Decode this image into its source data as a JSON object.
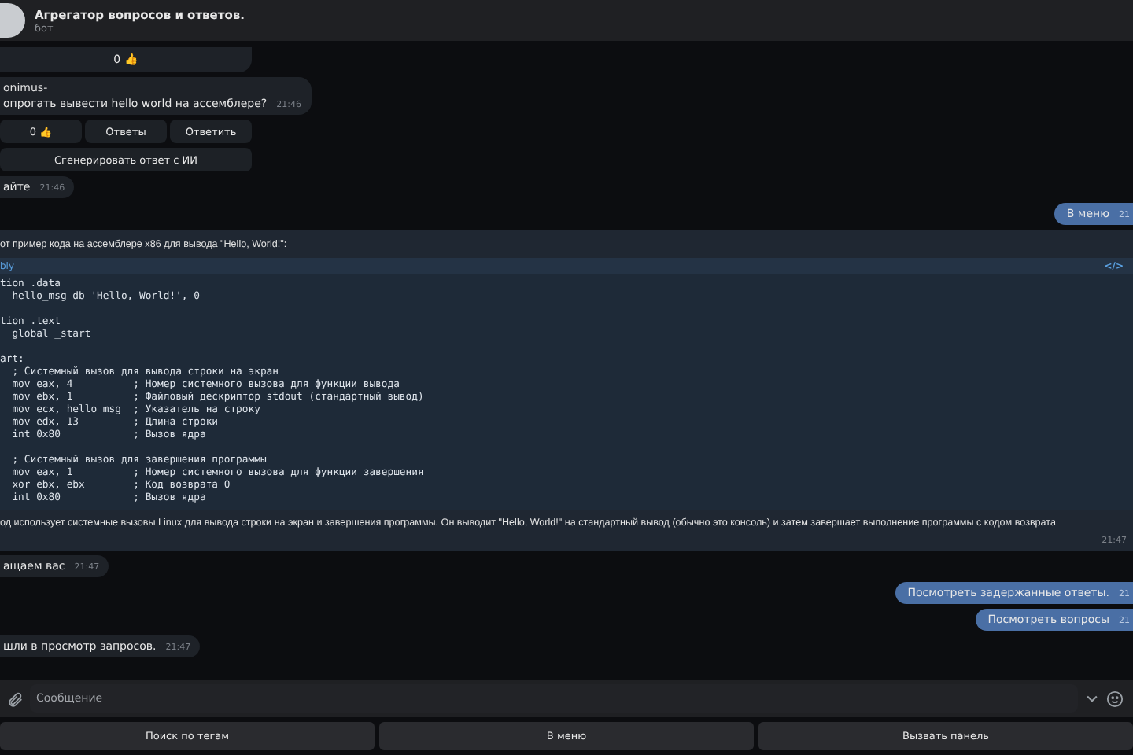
{
  "header": {
    "title": "Агрегатор вопросов и ответов.",
    "subtitle": "бот"
  },
  "messages": [
    {
      "kind": "reactions",
      "outgoing": false,
      "count": "0",
      "emoji": "👍"
    },
    {
      "kind": "text",
      "outgoing": false,
      "author": "onimus-",
      "text": "опрогать вывести hello world на ассемблере?",
      "time": "21:46"
    },
    {
      "kind": "buttons",
      "outgoing": false,
      "buttons": [
        {
          "label": "0 👍"
        },
        {
          "label": "Ответы"
        },
        {
          "label": "Ответить"
        }
      ]
    },
    {
      "kind": "buttons",
      "outgoing": false,
      "buttons": [
        {
          "label": "Сгенерировать ответ с ИИ"
        }
      ]
    },
    {
      "kind": "text",
      "outgoing": false,
      "text": "айте",
      "time": "21:46"
    },
    {
      "kind": "text",
      "outgoing": true,
      "text": "В меню",
      "time": "21"
    },
    {
      "kind": "code",
      "outgoing": false,
      "intro": "от пример кода на ассемблере x86 для вывода \"Hello, World!\":",
      "language": "bly",
      "code_icon": "</>",
      "code_blocks": [
        [
          "tion .data",
          "  hello_msg db 'Hello, World!', 0"
        ],
        [
          "tion .text",
          "  global _start"
        ],
        [
          "art:",
          "  ; Системный вызов для вывода строки на экран",
          "  mov eax, 4          ; Номер системного вызова для функции вывода",
          "  mov ebx, 1          ; Файловый дескриптор stdout (стандартный вывод)",
          "  mov ecx, hello_msg  ; Указатель на строку",
          "  mov edx, 13         ; Длина строки",
          "  int 0x80            ; Вызов ядра"
        ],
        [
          "  ; Системный вызов для завершения программы",
          "  mov eax, 1          ; Номер системного вызова для функции завершения",
          "  xor ebx, ebx        ; Код возврата 0",
          "  int 0x80            ; Вызов ядра"
        ]
      ],
      "outro": "од использует системные вызовы Linux для вывода строки на экран и завершения программы. Он выводит \"Hello, World!\" на стандартный вывод (обычно это консоль) и затем завершает выполнение программы с кодом возврата",
      "time": "21:47"
    },
    {
      "kind": "text",
      "outgoing": false,
      "text": "ащаем вас",
      "time": "21:47"
    },
    {
      "kind": "text",
      "outgoing": true,
      "text": "Посмотреть задержанные ответы.",
      "time": "21"
    },
    {
      "kind": "text",
      "outgoing": true,
      "text": "Посмотреть вопросы",
      "time": "21"
    },
    {
      "kind": "text",
      "outgoing": false,
      "text": "шли в просмотр запросов.",
      "time": "21:47"
    }
  ],
  "composer": {
    "placeholder": "Сообщение"
  },
  "keyboard": [
    {
      "label": "Поиск по тегам"
    },
    {
      "label": "В меню"
    },
    {
      "label": "Вызвать панель"
    }
  ]
}
